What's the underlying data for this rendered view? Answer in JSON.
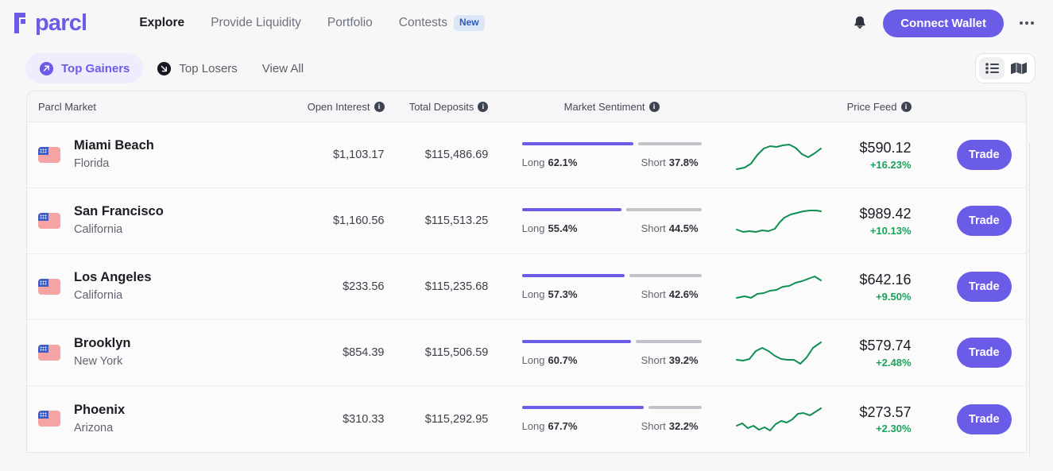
{
  "brand": {
    "name": "parcl"
  },
  "nav": {
    "items": [
      {
        "label": "Explore",
        "active": true
      },
      {
        "label": "Provide Liquidity",
        "active": false
      },
      {
        "label": "Portfolio",
        "active": false
      },
      {
        "label": "Contests",
        "active": false,
        "badge": "New"
      }
    ],
    "connect_wallet": "Connect Wallet",
    "notifications_icon": "bell-icon",
    "more_icon": "more-horizontal-icon"
  },
  "filters": {
    "tabs": [
      {
        "label": "Top Gainers",
        "icon": "arrow-up-right-circle-icon",
        "active": true
      },
      {
        "label": "Top Losers",
        "icon": "arrow-down-right-circle-icon",
        "active": false
      },
      {
        "label": "View All",
        "icon": null,
        "active": false
      }
    ],
    "views": [
      {
        "name": "list-view",
        "icon": "list-icon",
        "active": true
      },
      {
        "name": "map-view",
        "icon": "map-icon",
        "active": false
      }
    ]
  },
  "table": {
    "columns": {
      "market": "Parcl Market",
      "open_interest": "Open Interest",
      "total_deposits": "Total Deposits",
      "market_sentiment": "Market Sentiment",
      "price_feed": "Price Feed"
    },
    "labels": {
      "long": "Long",
      "short": "Short",
      "trade": "Trade"
    },
    "rows": [
      {
        "flag": "us-flag-icon",
        "city": "Miami Beach",
        "state": "Florida",
        "open_interest": "$1,103.17",
        "total_deposits": "$115,486.69",
        "long_pct": "62.1%",
        "short_pct": "37.8%",
        "long_value": 62.1,
        "short_value": 37.8,
        "price": "$590.12",
        "change": "+16.23%",
        "spark": "2,40 12,38 20,33 28,22 36,14 44,11 52,12 60,10 68,9 76,13 84,21 92,25 100,20 108,14"
      },
      {
        "flag": "us-flag-icon",
        "city": "San Francisco",
        "state": "California",
        "open_interest": "$1,160.56",
        "total_deposits": "$115,513.25",
        "long_pct": "55.4%",
        "short_pct": "44.5%",
        "long_value": 55.4,
        "short_value": 44.5,
        "price": "$989.42",
        "change": "+10.13%",
        "spark": "2,33 10,36 18,35 26,36 34,34 42,35 50,32 56,24 62,18 70,14 78,12 86,10 94,9 102,9 108,10"
      },
      {
        "flag": "us-flag-icon",
        "city": "Los Angeles",
        "state": "California",
        "open_interest": "$233.56",
        "total_deposits": "$115,235.68",
        "long_pct": "57.3%",
        "short_pct": "42.6%",
        "long_value": 57.3,
        "short_value": 42.6,
        "price": "$642.16",
        "change": "+9.50%",
        "spark": "2,36 12,34 20,36 28,31 36,30 44,27 52,26 60,22 68,21 76,17 84,15 92,12 100,9 108,14"
      },
      {
        "flag": "us-flag-icon",
        "city": "Brooklyn",
        "state": "New York",
        "open_interest": "$854.39",
        "total_deposits": "$115,506.59",
        "long_pct": "60.7%",
        "short_pct": "39.2%",
        "long_value": 60.7,
        "short_value": 39.2,
        "price": "$579.74",
        "change": "+2.48%",
        "spark": "2,31 10,32 18,30 26,20 34,16 42,20 50,26 58,30 66,31 74,31 82,36 90,28 98,16 108,9"
      },
      {
        "flag": "us-flag-icon",
        "city": "Phoenix",
        "state": "Arizona",
        "open_interest": "$310.33",
        "total_deposits": "$115,292.95",
        "long_pct": "67.7%",
        "short_pct": "32.2%",
        "long_value": 67.7,
        "short_value": 32.2,
        "price": "$273.57",
        "change": "+2.30%",
        "spark": "2,30 9,27 16,33 23,30 30,35 37,32 44,36 51,28 58,24 65,26 72,22 79,15 86,14 94,17 102,12 108,8"
      }
    ]
  },
  "colors": {
    "brand_purple": "#6b5ce7",
    "positive_green": "#19a35a",
    "short_gray": "#c2c3c9",
    "badge_blue_bg": "#dbe6f7",
    "badge_blue_text": "#2f5bb7"
  }
}
